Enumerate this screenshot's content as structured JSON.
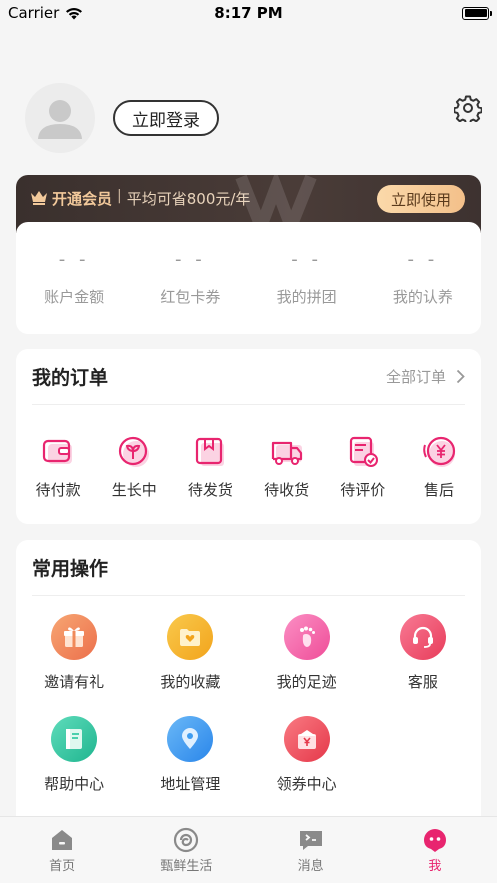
{
  "status_bar": {
    "carrier": "Carrier",
    "time": "8:17 PM"
  },
  "profile": {
    "login_label": "立即登录"
  },
  "vip": {
    "title": "开通会员",
    "separator": "|",
    "subtitle": "平均可省800元/年",
    "button_label": "立即使用"
  },
  "stats": [
    {
      "value": "- -",
      "label": "账户金额"
    },
    {
      "value": "- -",
      "label": "红包卡券"
    },
    {
      "value": "- -",
      "label": "我的拼团"
    },
    {
      "value": "- -",
      "label": "我的认养"
    }
  ],
  "orders": {
    "title": "我的订单",
    "all_label": "全部订单",
    "items": [
      {
        "label": "待付款",
        "icon": "wallet-icon"
      },
      {
        "label": "生长中",
        "icon": "sprout-icon"
      },
      {
        "label": "待发货",
        "icon": "package-icon"
      },
      {
        "label": "待收货",
        "icon": "truck-icon"
      },
      {
        "label": "待评价",
        "icon": "review-icon"
      },
      {
        "label": "售后",
        "icon": "refund-icon"
      }
    ]
  },
  "operations": {
    "title": "常用操作",
    "items": [
      {
        "label": "邀请有礼",
        "icon": "gift-icon",
        "color": "#f08a5a"
      },
      {
        "label": "我的收藏",
        "icon": "favorite-folder-icon",
        "color": "#f5b52e"
      },
      {
        "label": "我的足迹",
        "icon": "footprint-icon",
        "color": "#f25ca0"
      },
      {
        "label": "客服",
        "icon": "headset-icon",
        "color": "#f0506e"
      },
      {
        "label": "帮助中心",
        "icon": "help-book-icon",
        "color": "#35c9a4"
      },
      {
        "label": "地址管理",
        "icon": "location-pin-icon",
        "color": "#3f9cf0"
      },
      {
        "label": "领券中心",
        "icon": "coupon-icon",
        "color": "#f04e5e"
      }
    ]
  },
  "tabs": [
    {
      "label": "首页",
      "icon": "home-icon"
    },
    {
      "label": "甄鲜生活",
      "icon": "life-icon"
    },
    {
      "label": "消息",
      "icon": "message-icon"
    },
    {
      "label": "我",
      "icon": "profile-icon",
      "active": true
    }
  ],
  "colors": {
    "accent": "#e8256f",
    "vip_gold": "#f2c99b"
  }
}
